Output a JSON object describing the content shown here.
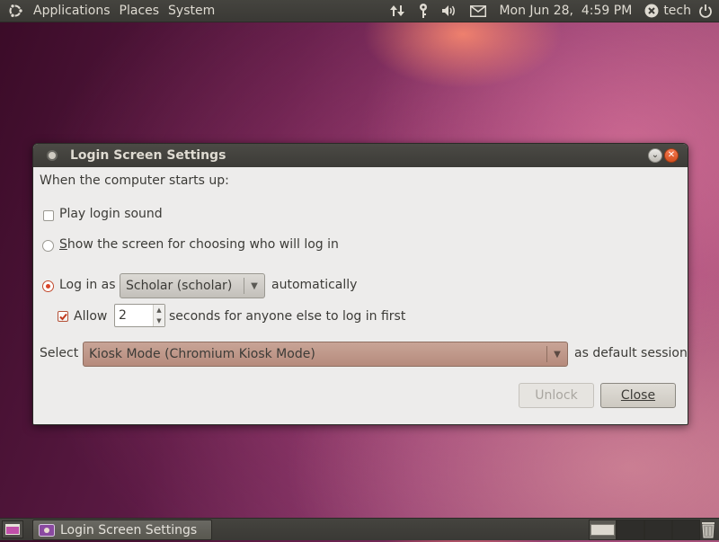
{
  "top_panel": {
    "menus": [
      "Applications",
      "Places",
      "System"
    ],
    "tray_icons": [
      "network-updown-icon",
      "keyring-icon",
      "volume-icon",
      "mail-icon"
    ],
    "clock": "Mon Jun 28,  4:59 PM",
    "user": "tech"
  },
  "dialog": {
    "title": "Login Screen Settings",
    "intro": "When the computer starts up:",
    "play_sound": {
      "label": "Play login sound",
      "checked": false
    },
    "show_screen": {
      "label": "Show the screen for choosing who will log in",
      "selected": false
    },
    "login_as": {
      "label": "Log in as",
      "user_value": "Scholar (scholar)",
      "suffix": "automatically",
      "selected": true
    },
    "allow": {
      "label": "Allow",
      "checked": true,
      "seconds": "2",
      "suffix": "seconds for anyone else to log in first"
    },
    "session": {
      "label": "Select",
      "value": "Kiosk Mode (Chromium Kiosk Mode)",
      "suffix": "as default session"
    },
    "buttons": {
      "unlock": "Unlock",
      "close": "Close"
    }
  },
  "bottom_panel": {
    "task_label": "Login Screen Settings",
    "workspaces": 4,
    "active_workspace": 1
  },
  "colors": {
    "panel": "#3c3b37",
    "dialog_bg": "#edeceb",
    "accent_orange": "#d9452a",
    "combo_brown": "#b68b7c"
  }
}
